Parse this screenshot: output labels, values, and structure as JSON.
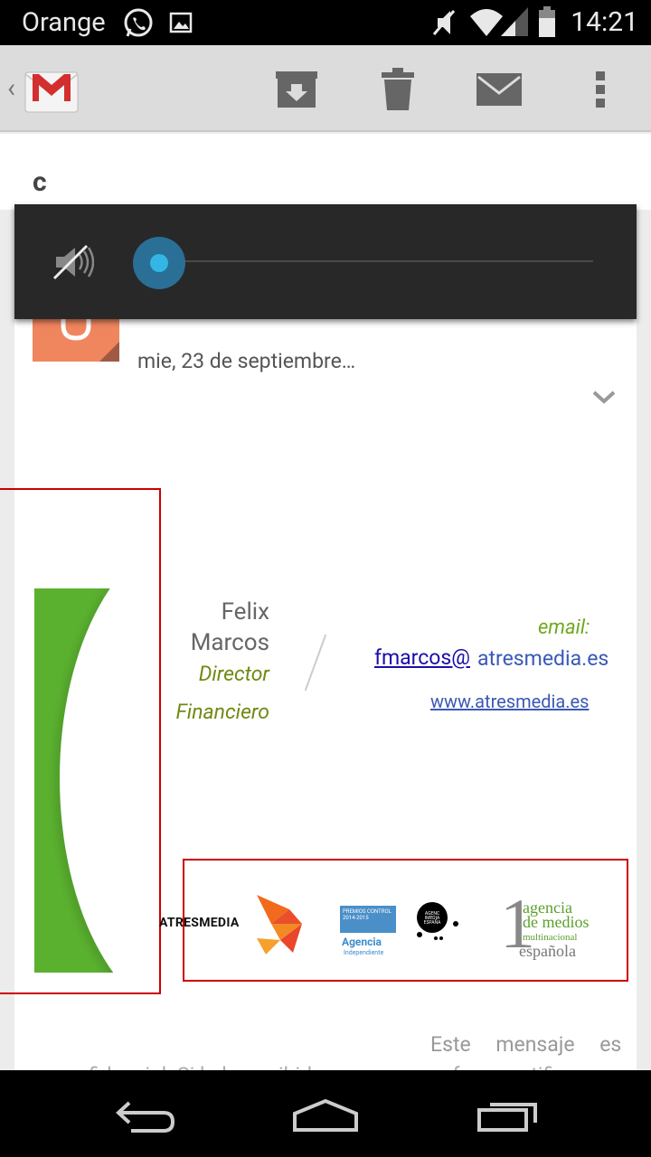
{
  "status_bar": {
    "carrier": "Orange",
    "time": "14:21"
  },
  "action_bar": {
    "back_glyph": "‹"
  },
  "email": {
    "subject": "c",
    "date": "mie, 23 de septiembre…"
  },
  "signature": {
    "name_first": "Felix",
    "name_last": "Marcos",
    "title_1": "Director",
    "title_2": "Financiero",
    "email_label": "email:",
    "email_user": "fmarcos@",
    "email_domain": "atresmedia.es",
    "website": "www.atresmedia.es"
  },
  "logos": {
    "atresmedia": "ATRESMEDIA",
    "premios": "PREMIOS CONTROL 2014-2015",
    "agencia": "Agencia",
    "independiente": "Independiente",
    "agenc_circle": "AGENC IMEDIA ESPAÑA",
    "digit": "1",
    "agencia_line": "agencia",
    "medios_line": "de medios",
    "multinacional_line": "multinacional",
    "espanola_line": "española"
  },
  "disclaimer": {
    "line1": "Este mensaje es",
    "line2": "confidencial. Si lo ha recibido por error, por favor, notifique..."
  },
  "colors": {
    "accent_blue": "#33b5e5",
    "signature_green": "#5ab02f",
    "title_olive": "#6f8a14"
  }
}
